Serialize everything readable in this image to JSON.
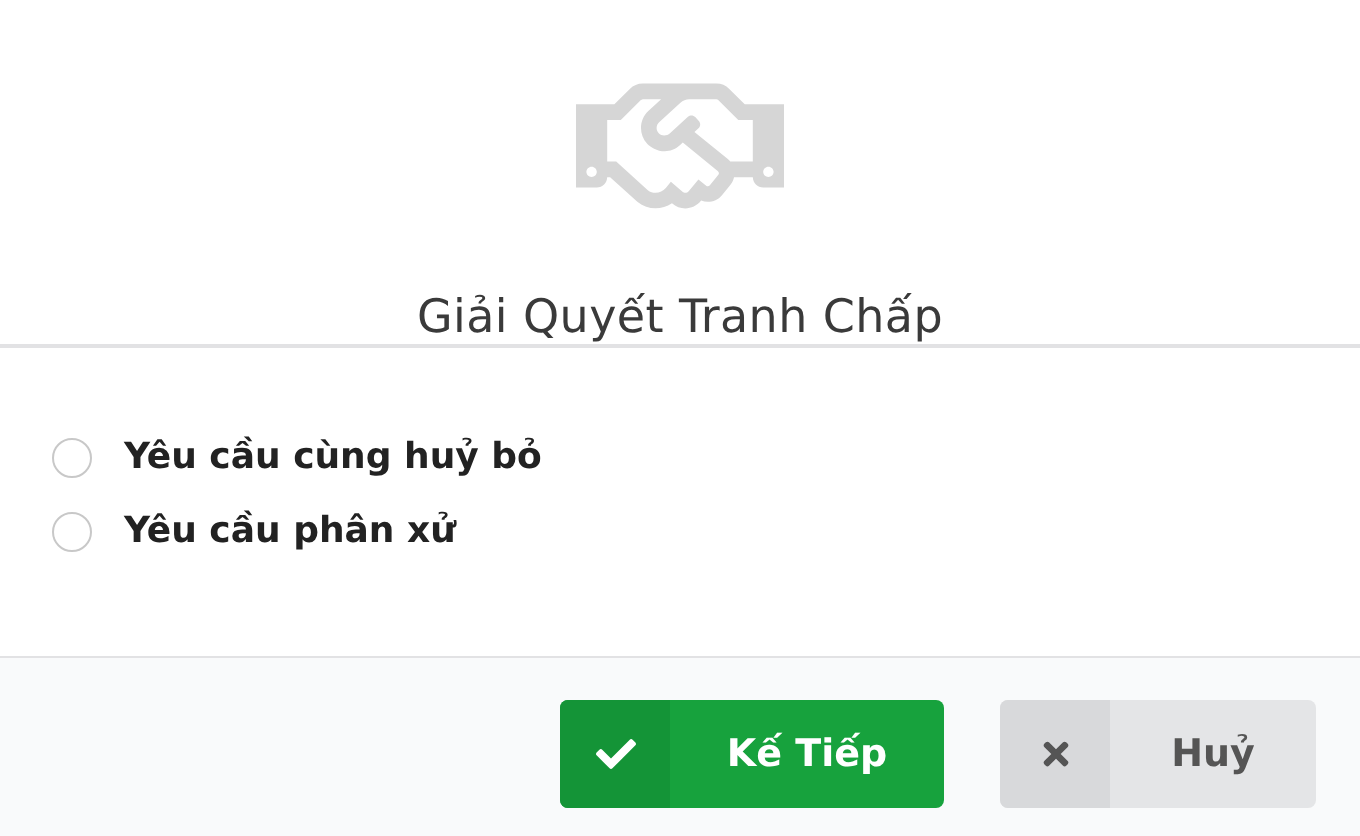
{
  "title": "Giải Quyết Tranh Chấp",
  "options": [
    {
      "label": "Yêu cầu cùng huỷ bỏ",
      "selected": false
    },
    {
      "label": "Yêu cầu phân xử",
      "selected": false
    }
  ],
  "buttons": [
    {
      "kind": "primary",
      "label": "Kế Tiếp"
    },
    {
      "kind": "cancel",
      "label": "Huỷ"
    }
  ]
}
